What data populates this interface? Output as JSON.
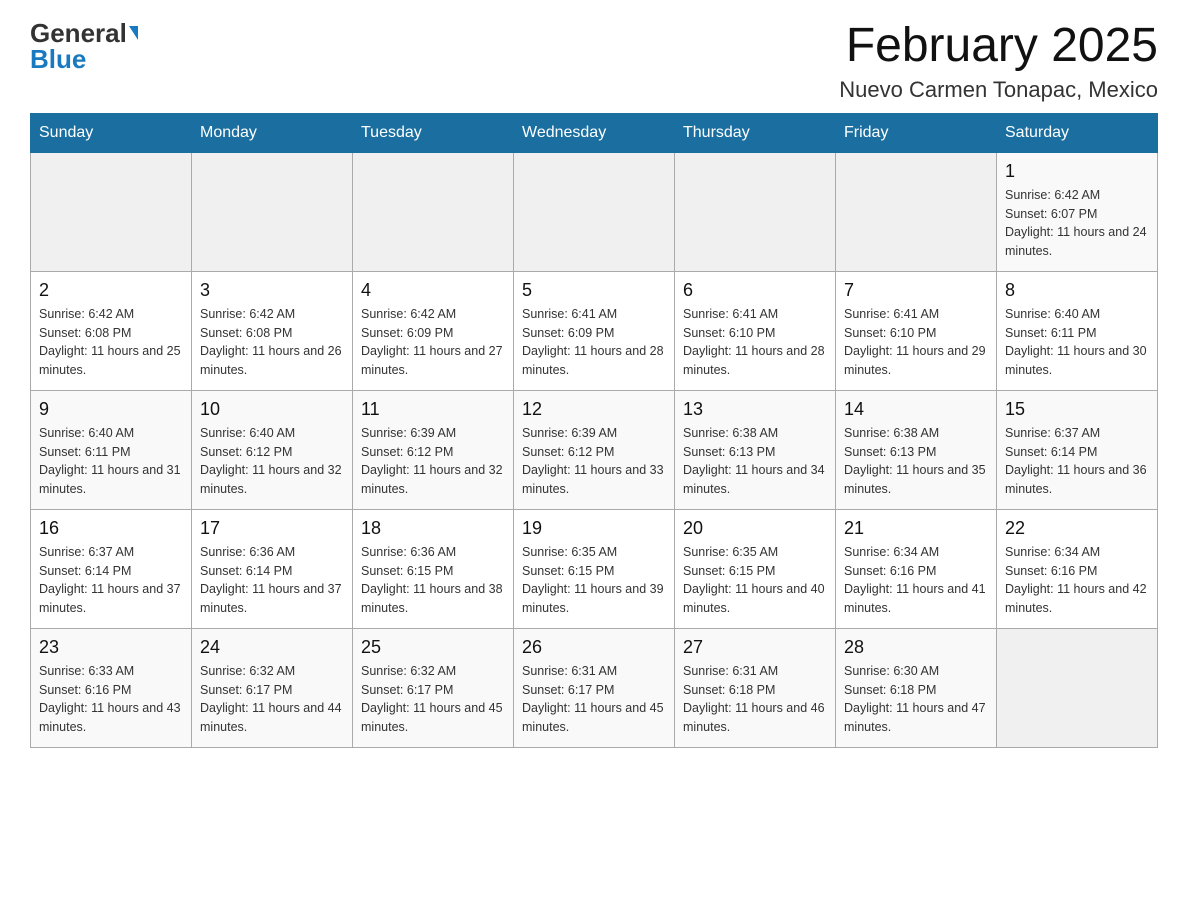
{
  "logo": {
    "general": "General",
    "blue": "Blue"
  },
  "header": {
    "month": "February 2025",
    "location": "Nuevo Carmen Tonapac, Mexico"
  },
  "weekdays": [
    "Sunday",
    "Monday",
    "Tuesday",
    "Wednesday",
    "Thursday",
    "Friday",
    "Saturday"
  ],
  "weeks": [
    [
      {
        "day": "",
        "info": ""
      },
      {
        "day": "",
        "info": ""
      },
      {
        "day": "",
        "info": ""
      },
      {
        "day": "",
        "info": ""
      },
      {
        "day": "",
        "info": ""
      },
      {
        "day": "",
        "info": ""
      },
      {
        "day": "1",
        "info": "Sunrise: 6:42 AM\nSunset: 6:07 PM\nDaylight: 11 hours and 24 minutes."
      }
    ],
    [
      {
        "day": "2",
        "info": "Sunrise: 6:42 AM\nSunset: 6:08 PM\nDaylight: 11 hours and 25 minutes."
      },
      {
        "day": "3",
        "info": "Sunrise: 6:42 AM\nSunset: 6:08 PM\nDaylight: 11 hours and 26 minutes."
      },
      {
        "day": "4",
        "info": "Sunrise: 6:42 AM\nSunset: 6:09 PM\nDaylight: 11 hours and 27 minutes."
      },
      {
        "day": "5",
        "info": "Sunrise: 6:41 AM\nSunset: 6:09 PM\nDaylight: 11 hours and 28 minutes."
      },
      {
        "day": "6",
        "info": "Sunrise: 6:41 AM\nSunset: 6:10 PM\nDaylight: 11 hours and 28 minutes."
      },
      {
        "day": "7",
        "info": "Sunrise: 6:41 AM\nSunset: 6:10 PM\nDaylight: 11 hours and 29 minutes."
      },
      {
        "day": "8",
        "info": "Sunrise: 6:40 AM\nSunset: 6:11 PM\nDaylight: 11 hours and 30 minutes."
      }
    ],
    [
      {
        "day": "9",
        "info": "Sunrise: 6:40 AM\nSunset: 6:11 PM\nDaylight: 11 hours and 31 minutes."
      },
      {
        "day": "10",
        "info": "Sunrise: 6:40 AM\nSunset: 6:12 PM\nDaylight: 11 hours and 32 minutes."
      },
      {
        "day": "11",
        "info": "Sunrise: 6:39 AM\nSunset: 6:12 PM\nDaylight: 11 hours and 32 minutes."
      },
      {
        "day": "12",
        "info": "Sunrise: 6:39 AM\nSunset: 6:12 PM\nDaylight: 11 hours and 33 minutes."
      },
      {
        "day": "13",
        "info": "Sunrise: 6:38 AM\nSunset: 6:13 PM\nDaylight: 11 hours and 34 minutes."
      },
      {
        "day": "14",
        "info": "Sunrise: 6:38 AM\nSunset: 6:13 PM\nDaylight: 11 hours and 35 minutes."
      },
      {
        "day": "15",
        "info": "Sunrise: 6:37 AM\nSunset: 6:14 PM\nDaylight: 11 hours and 36 minutes."
      }
    ],
    [
      {
        "day": "16",
        "info": "Sunrise: 6:37 AM\nSunset: 6:14 PM\nDaylight: 11 hours and 37 minutes."
      },
      {
        "day": "17",
        "info": "Sunrise: 6:36 AM\nSunset: 6:14 PM\nDaylight: 11 hours and 37 minutes."
      },
      {
        "day": "18",
        "info": "Sunrise: 6:36 AM\nSunset: 6:15 PM\nDaylight: 11 hours and 38 minutes."
      },
      {
        "day": "19",
        "info": "Sunrise: 6:35 AM\nSunset: 6:15 PM\nDaylight: 11 hours and 39 minutes."
      },
      {
        "day": "20",
        "info": "Sunrise: 6:35 AM\nSunset: 6:15 PM\nDaylight: 11 hours and 40 minutes."
      },
      {
        "day": "21",
        "info": "Sunrise: 6:34 AM\nSunset: 6:16 PM\nDaylight: 11 hours and 41 minutes."
      },
      {
        "day": "22",
        "info": "Sunrise: 6:34 AM\nSunset: 6:16 PM\nDaylight: 11 hours and 42 minutes."
      }
    ],
    [
      {
        "day": "23",
        "info": "Sunrise: 6:33 AM\nSunset: 6:16 PM\nDaylight: 11 hours and 43 minutes."
      },
      {
        "day": "24",
        "info": "Sunrise: 6:32 AM\nSunset: 6:17 PM\nDaylight: 11 hours and 44 minutes."
      },
      {
        "day": "25",
        "info": "Sunrise: 6:32 AM\nSunset: 6:17 PM\nDaylight: 11 hours and 45 minutes."
      },
      {
        "day": "26",
        "info": "Sunrise: 6:31 AM\nSunset: 6:17 PM\nDaylight: 11 hours and 45 minutes."
      },
      {
        "day": "27",
        "info": "Sunrise: 6:31 AM\nSunset: 6:18 PM\nDaylight: 11 hours and 46 minutes."
      },
      {
        "day": "28",
        "info": "Sunrise: 6:30 AM\nSunset: 6:18 PM\nDaylight: 11 hours and 47 minutes."
      },
      {
        "day": "",
        "info": ""
      }
    ]
  ]
}
